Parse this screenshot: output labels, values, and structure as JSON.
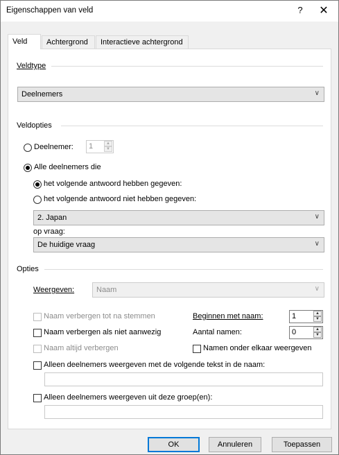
{
  "window": {
    "title": "Eigenschappen van veld",
    "help": "?",
    "close": "✕"
  },
  "tabs": [
    {
      "label": "Veld",
      "active": true
    },
    {
      "label": "Achtergrond",
      "active": false
    },
    {
      "label": "Interactieve achtergrond",
      "active": false
    }
  ],
  "veldtype": {
    "group_label": "Veldtype",
    "selected": "Deelnemers"
  },
  "veldopties": {
    "group_label": "Veldopties",
    "deelnemer_label": "Deelnemer:",
    "deelnemer_value": "1",
    "alle_label": "Alle deelnemers die",
    "wel_label": "het volgende antwoord hebben gegeven:",
    "niet_label": "het volgende antwoord niet hebben gegeven:",
    "answer_selected": "2. Japan",
    "question_label": "op vraag:",
    "question_selected": "De huidige vraag"
  },
  "opties": {
    "group_label": "Opties",
    "weergeven_label": "Weergeven:",
    "weergeven_value": "Naam",
    "verbergen_tot_label": "Naam verbergen tot na stemmen",
    "verbergen_afwezig_label": "Naam verbergen als niet aanwezig",
    "altijd_verbergen_label": "Naam altijd verbergen",
    "beginnen_label": "Beginnen met naam:",
    "beginnen_value": "1",
    "aantal_label": "Aantal namen:",
    "aantal_value": "0",
    "onder_elkaar_label": "Namen onder elkaar weergeven",
    "tekst_label": "Alleen deelnemers weergeven met de volgende tekst in de naam:",
    "tekst_value": "",
    "groep_label": "Alleen deelnemers weergeven uit deze groep(en):",
    "groep_value": ""
  },
  "buttons": {
    "ok": "OK",
    "cancel": "Annuleren",
    "apply": "Toepassen"
  }
}
